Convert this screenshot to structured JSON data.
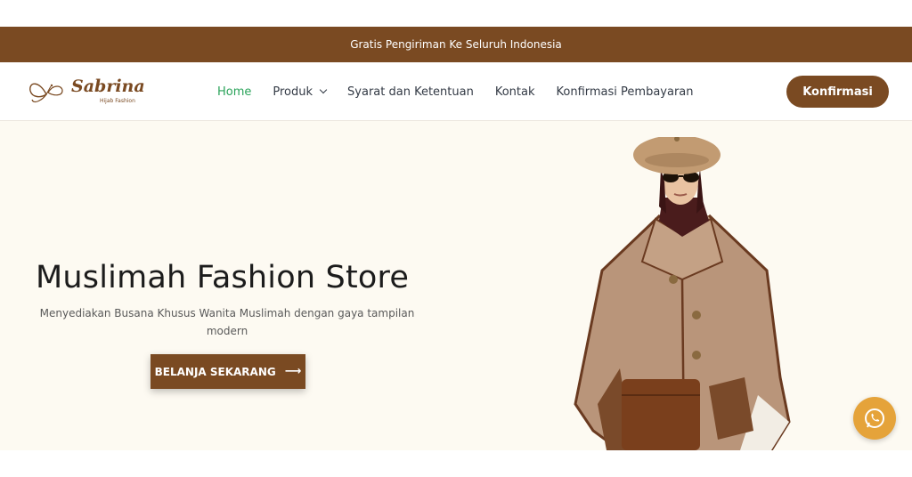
{
  "topbar": {
    "text": "Gratis Pengiriman Ke Seluruh Indonesia"
  },
  "logo": {
    "name": "Sabrina",
    "tagline": "Hijab Fashion"
  },
  "nav": {
    "items": [
      {
        "label": "Home",
        "active": true
      },
      {
        "label": "Produk",
        "dropdown": true
      },
      {
        "label": "Syarat dan Ketentuan"
      },
      {
        "label": "Kontak"
      },
      {
        "label": "Konfirmasi Pembayaran"
      }
    ]
  },
  "header": {
    "cta_label": "Konfirmasi"
  },
  "hero": {
    "title": "Muslimah Fashion Store",
    "subtitle": "Menyediakan Busana Khusus Wanita Muslimah dengan gaya tampilan modern",
    "button_label": "BELANJA SEKARANG",
    "button_icon": "arrow-right-icon"
  },
  "floating": {
    "icon": "whatsapp-icon"
  },
  "colors": {
    "brand_brown": "#7a4a22",
    "active_nav": "#2aa35a",
    "hero_bg": "#fdfaf2",
    "whatsapp_button": "#e5a33a"
  }
}
